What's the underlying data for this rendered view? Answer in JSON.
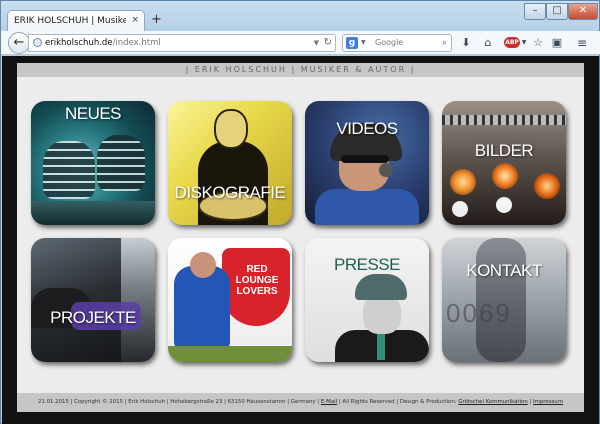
{
  "browser": {
    "tab_title": "ERIK HOLSCHUH | Musiker & Au...",
    "tab_close": "×",
    "new_tab": "+",
    "url_host": "erikholschuh.de",
    "url_path": "/index.html",
    "search_engine": "g",
    "search_placeholder": "Google",
    "window_min": "–",
    "window_max": "□",
    "window_close": "✕"
  },
  "site": {
    "header_title": "| ERIK HOLSCHUH | MUSIKER & AUTOR |",
    "tiles": [
      {
        "label": "NEUES"
      },
      {
        "label": "DISKOGRAFIE"
      },
      {
        "label": "VIDEOS"
      },
      {
        "label": "BILDER"
      },
      {
        "label": "PROJEKTE"
      },
      {
        "label": ""
      },
      {
        "label": "PRESSE"
      },
      {
        "label": "KONTAKT"
      }
    ],
    "tile_red_text": "RED LOUNGE LOVERS",
    "tile_kontakt_text": "0069",
    "footer": {
      "prefix": "21.01.2015 | Copyright © 2015 | Erik Holschuh | Hohebergstraße 23 | 63150 Heusenstamm | Germany | ",
      "email_label": "E-Mail",
      "middle": " | All Rights Reserved | Design & Production: ",
      "agency_label": "Grötschel Kommunikation",
      "sep": " | ",
      "impressum_label": "Impressum"
    }
  },
  "colors": {
    "presse_label": "#1f5f52",
    "chrome_bg": "#aecbe5",
    "site_bg": "#ececec"
  }
}
